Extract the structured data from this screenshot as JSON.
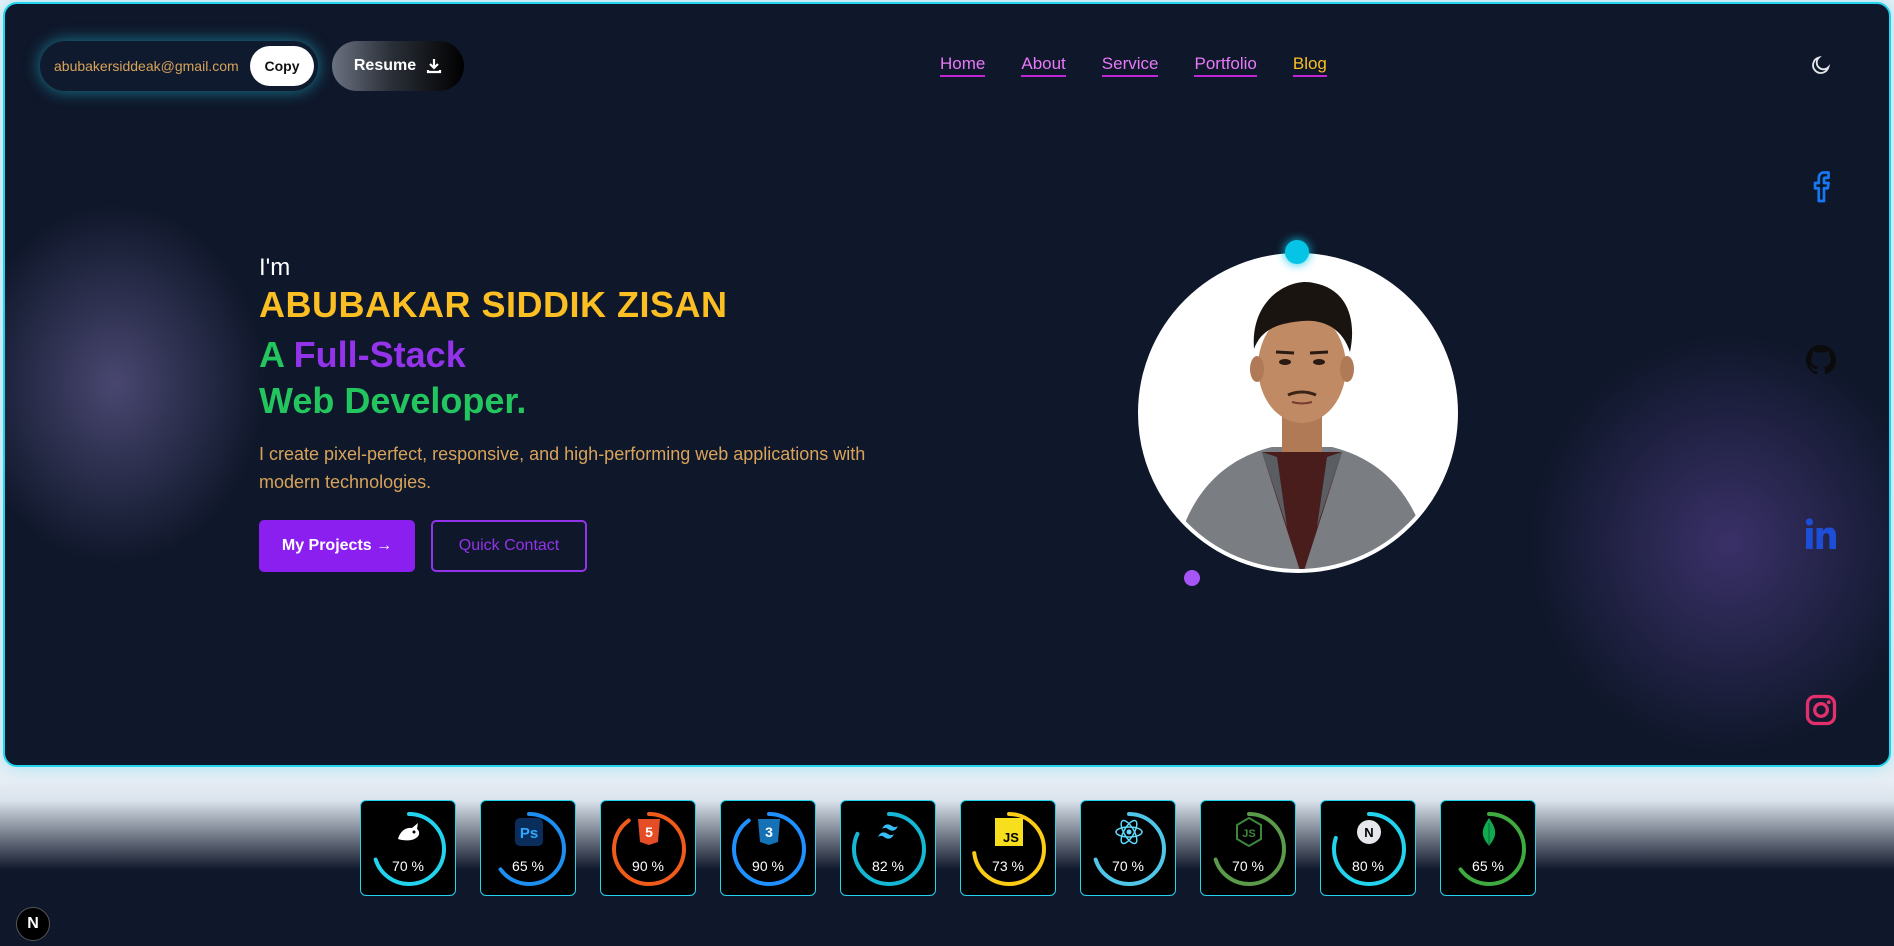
{
  "header": {
    "email": "abubakersiddeak@gmail.com",
    "copy_label": "Copy",
    "resume_label": "Resume",
    "nav": [
      {
        "label": "Home"
      },
      {
        "label": "About"
      },
      {
        "label": "Service"
      },
      {
        "label": "Portfolio"
      },
      {
        "label": "Blog"
      }
    ],
    "theme_icon": "moon-icon"
  },
  "hero": {
    "intro": "I'm",
    "name": "ABUBAKAR SIDDIK ZISAN",
    "role_prefix": "A ",
    "role_highlight": "Full-Stack",
    "role_line2": "Web Developer.",
    "description": "I create pixel-perfect, responsive, and high-performing web applications with modern technologies.",
    "primary_button": "My Projects →",
    "secondary_button": "Quick Contact"
  },
  "social": [
    "facebook-icon",
    "github-icon",
    "linkedin-icon",
    "instagram-icon"
  ],
  "skills": [
    {
      "icon": "gimp-icon",
      "percent_label": "70 %",
      "value": 70,
      "color": "#22d3ee"
    },
    {
      "icon": "photoshop-icon",
      "percent_label": "65 %",
      "value": 65,
      "color": "#1d8ff0"
    },
    {
      "icon": "html5-icon",
      "percent_label": "90 %",
      "value": 90,
      "color": "#f05a1a"
    },
    {
      "icon": "css3-icon",
      "percent_label": "90 %",
      "value": 90,
      "color": "#1e90ff"
    },
    {
      "icon": "tailwind-icon",
      "percent_label": "82 %",
      "value": 82,
      "color": "#14b8d4"
    },
    {
      "icon": "javascript-icon",
      "percent_label": "73 %",
      "value": 73,
      "color": "#facc15"
    },
    {
      "icon": "react-icon",
      "percent_label": "70 %",
      "value": 70,
      "color": "#4fc6e8"
    },
    {
      "icon": "nodejs-icon",
      "percent_label": "70 %",
      "value": 70,
      "color": "#5c9a4b"
    },
    {
      "icon": "nextjs-icon",
      "percent_label": "80 %",
      "value": 80,
      "color": "#22d3ee"
    },
    {
      "icon": "mongodb-icon",
      "percent_label": "65 %",
      "value": 65,
      "color": "#3faa3f"
    }
  ],
  "colors": {
    "accent_cyan": "#22d3ee",
    "name_amber": "#fbbf24",
    "role_green": "#22c55e",
    "role_purple": "#9333ea",
    "background": "#0f172a"
  },
  "dev_badge": "N"
}
